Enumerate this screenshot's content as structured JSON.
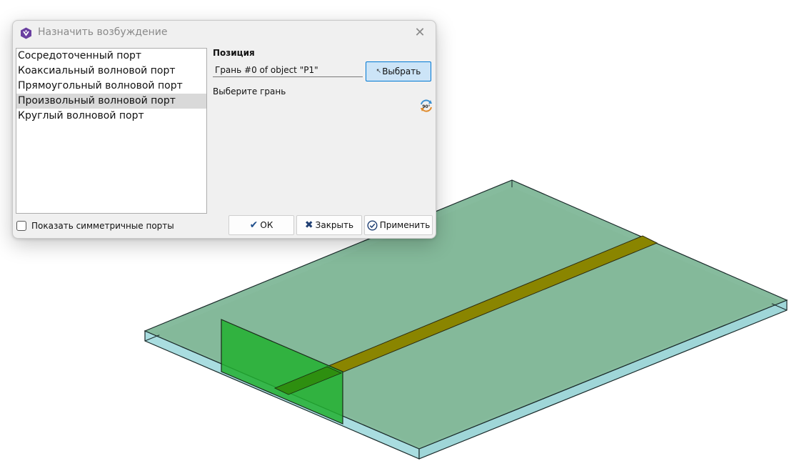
{
  "dialog": {
    "title": "Назначить возбуждение",
    "close_glyph": "✕",
    "icon": "app-logo-icon",
    "port_types": [
      {
        "label": "Сосредоточенный порт",
        "selected": false
      },
      {
        "label": "Коаксиальный волновой порт",
        "selected": false
      },
      {
        "label": "Прямоугольный волновой порт",
        "selected": false
      },
      {
        "label": "Произвольный волновой порт",
        "selected": true
      },
      {
        "label": "Круглый волновой порт",
        "selected": false
      }
    ],
    "position_section": {
      "title": "Позиция",
      "field_value": "Грань #0 of object \"P1\"",
      "select_button": "Выбрать",
      "hint": "Выберите грань",
      "rotate_icon_label": "90°"
    },
    "show_symmetric": {
      "label": "Показать симметричные порты",
      "checked": false
    },
    "buttons": {
      "ok": "ОК",
      "close": "Закрыть",
      "apply": "Применить"
    }
  },
  "colors": {
    "selected_row": "#d9d9d9",
    "select_button_bg": "#cce4f7",
    "select_button_border": "#0078d4",
    "substrate_fill": "#6fb089",
    "substrate_edge": "#a9dde0",
    "trace_fill": "#8a8500",
    "port_fill": "#22b030",
    "title_icon": "#6a3fa0"
  }
}
